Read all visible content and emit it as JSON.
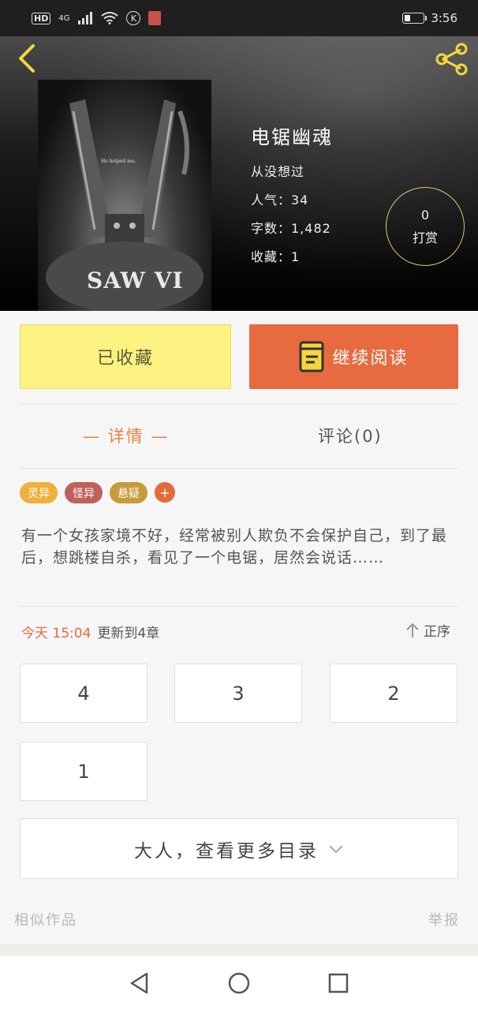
{
  "status_bar": {
    "hd": "HD",
    "network": "4G",
    "k_icon": "K",
    "time": "3:56"
  },
  "header": {
    "back_icon": "chevron-left-icon",
    "share_icon": "share-icon"
  },
  "poster": {
    "tagline": "He helped me.",
    "logo": "SAW VI"
  },
  "book": {
    "title": "电锯幽魂",
    "author": "从没想过",
    "popularity": "人气：34",
    "word_count": "字数：1,482",
    "favorites": "收藏：1"
  },
  "reward": {
    "count": "0",
    "label": "打赏"
  },
  "actions": {
    "collected_label": "已收藏",
    "read_label": "继续阅读"
  },
  "tabs": {
    "detail": "— 详情 —",
    "comments": "评论(0)"
  },
  "tags": [
    {
      "label": "灵异",
      "color": "#f0b03c"
    },
    {
      "label": "怪异",
      "color": "#c0605a"
    },
    {
      "label": "悬疑",
      "color": "#c99a3a"
    },
    {
      "label": "+",
      "color": "#e56a3a"
    }
  ],
  "synopsis": "有一个女孩家境不好，经常被别人欺负不会保护自己，到了最后，想跳楼自杀，看见了一个电锯，居然会说话……",
  "update": {
    "time": "今天 15:04",
    "text": "更新到4章",
    "sort_label": "正序"
  },
  "chapters": [
    "4",
    "3",
    "2",
    "1"
  ],
  "more_directory": "大人，查看更多目录",
  "footer": {
    "similar": "相似作品",
    "report": "举报"
  },
  "colors": {
    "accent": "#e86a3f",
    "collected_bg": "#fbf281",
    "reward_ring": "#d9c77c"
  }
}
